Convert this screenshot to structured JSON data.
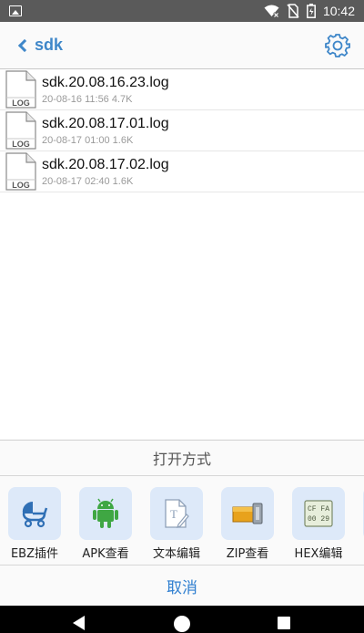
{
  "status_bar": {
    "time": "10:42"
  },
  "header": {
    "title": "sdk"
  },
  "files": [
    {
      "name": "sdk.20.08.16.23.log",
      "meta": "20-08-16 11:56 4.7K",
      "icon_label": "LOG"
    },
    {
      "name": "sdk.20.08.17.01.log",
      "meta": "20-08-17 01:00 1.6K",
      "icon_label": "LOG"
    },
    {
      "name": "sdk.20.08.17.02.log",
      "meta": "20-08-17 02:40 1.6K",
      "icon_label": "LOG"
    }
  ],
  "sheet": {
    "title": "打开方式",
    "apps": [
      {
        "label": "EBZ插件",
        "icon": "stroller-icon"
      },
      {
        "label": "APK查看",
        "icon": "android-icon"
      },
      {
        "label": "文本编辑",
        "icon": "text-edit-icon"
      },
      {
        "label": "ZIP查看",
        "icon": "zip-icon"
      },
      {
        "label": "HEX编辑",
        "icon": "hex-icon",
        "hex_lines": [
          "CF FA",
          "00 29"
        ]
      }
    ],
    "cancel_label": "取消"
  },
  "colors": {
    "accent": "#3f87c9",
    "tile_bg": "#dde9f9",
    "status_bar": "#5a5a5a"
  }
}
